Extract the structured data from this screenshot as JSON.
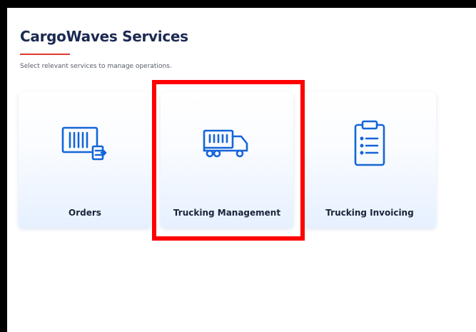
{
  "header": {
    "title": "CargoWaves Services",
    "subtitle": "Select relevant services to manage operations."
  },
  "cards": [
    {
      "label": "Orders",
      "icon": "container-order-icon"
    },
    {
      "label": "Trucking Management",
      "icon": "truck-icon"
    },
    {
      "label": "Trucking Invoicing",
      "icon": "clipboard-icon"
    }
  ],
  "colors": {
    "accent": "#e03a2f",
    "icon": "#1565d8",
    "highlight": "#ff0000",
    "title": "#1b2a52"
  }
}
